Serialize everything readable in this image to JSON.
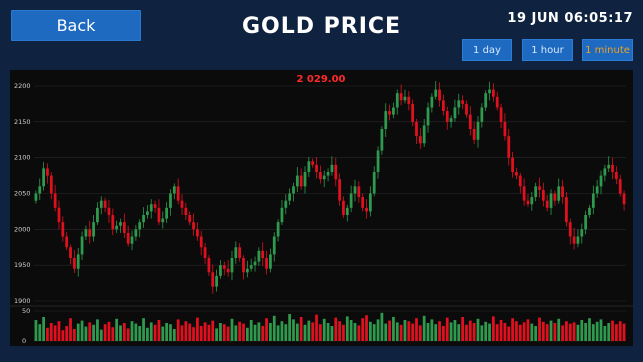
{
  "header": {
    "back_label": "Back",
    "title": "GOLD PRICE",
    "clock": "19 JUN 06:05:17"
  },
  "timeframes": [
    {
      "label": "1 day",
      "active": false
    },
    {
      "label": "1 hour",
      "active": false
    },
    {
      "label": "1 minute",
      "active": true
    }
  ],
  "colors": {
    "background": "#0f2340",
    "button": "#1d6ac0",
    "active_timeframe": "#f0a020",
    "up": "#2e9a4e",
    "down": "#e0101e",
    "doji": "#ffffff",
    "price_label": "#ff2a2a"
  },
  "chart_data": {
    "type": "candlestick",
    "current_price_label": "2 029.00",
    "price_axis": {
      "ticks": [
        1900,
        1950,
        2000,
        2050,
        2100,
        2150,
        2200
      ],
      "ylim": [
        1900,
        2200
      ]
    },
    "volume_axis": {
      "ticks": [
        0,
        50
      ],
      "ylim": [
        0,
        50
      ]
    },
    "close": [
      2050,
      2060,
      2085,
      2075,
      2050,
      2030,
      2010,
      1990,
      1975,
      1960,
      1945,
      1965,
      1990,
      2000,
      1990,
      2010,
      2030,
      2040,
      2030,
      2020,
      2000,
      2005,
      2010,
      1995,
      1980,
      1990,
      2000,
      2010,
      2020,
      2025,
      2035,
      2030,
      2010,
      2015,
      2030,
      2050,
      2060,
      2040,
      2030,
      2020,
      2010,
      2000,
      1990,
      1975,
      1960,
      1940,
      1920,
      1935,
      1950,
      1945,
      1940,
      1960,
      1975,
      1960,
      1940,
      1945,
      1950,
      1955,
      1970,
      1960,
      1945,
      1965,
      1990,
      2010,
      2030,
      2040,
      2050,
      2060,
      2075,
      2060,
      2080,
      2095,
      2090,
      2080,
      2070,
      2075,
      2080,
      2090,
      2070,
      2040,
      2020,
      2030,
      2050,
      2060,
      2045,
      2030,
      2025,
      2050,
      2080,
      2110,
      2140,
      2165,
      2160,
      2170,
      2190,
      2180,
      2185,
      2175,
      2150,
      2130,
      2120,
      2145,
      2170,
      2185,
      2195,
      2180,
      2165,
      2150,
      2155,
      2170,
      2180,
      2175,
      2160,
      2140,
      2125,
      2150,
      2170,
      2190,
      2195,
      2185,
      2170,
      2150,
      2130,
      2100,
      2080,
      2075,
      2060,
      2040,
      2035,
      2045,
      2060,
      2055,
      2040,
      2030,
      2050,
      2040,
      2060,
      2045,
      2010,
      1990,
      1980,
      1990,
      2000,
      2020,
      2030,
      2050,
      2060,
      2075,
      2085,
      2090,
      2080,
      2070,
      2050,
      2035
    ],
    "volume": [
      35,
      28,
      40,
      22,
      30,
      26,
      33,
      18,
      25,
      38,
      20,
      29,
      34,
      24,
      31,
      27,
      36,
      19,
      28,
      32,
      23,
      37,
      26,
      30,
      21,
      33,
      29,
      25,
      38,
      22,
      31,
      27,
      35,
      24,
      30,
      28,
      20,
      36,
      26,
      33,
      29,
      23,
      39,
      25,
      31,
      27,
      34,
      21,
      30,
      28,
      24,
      37,
      26,
      32,
      29,
      22,
      35,
      27,
      31,
      25,
      38,
      30,
      42,
      26,
      33,
      28,
      45,
      36,
      29,
      40,
      27,
      34,
      31,
      44,
      28,
      37,
      30,
      25,
      39,
      33,
      27,
      41,
      35,
      30,
      26,
      38,
      43,
      32,
      28,
      36,
      47,
      29,
      34,
      40,
      31,
      27,
      35,
      33,
      29,
      38,
      26,
      42,
      30,
      36,
      28,
      33,
      25,
      39,
      31,
      35,
      28,
      40,
      27,
      34,
      30,
      37,
      26,
      32,
      29,
      41,
      28,
      35,
      30,
      24,
      38,
      33,
      27,
      31,
      36,
      29,
      25,
      39,
      32,
      28,
      34,
      30,
      37,
      26,
      33,
      29,
      31,
      27,
      35,
      30,
      38,
      28,
      32,
      36,
      25,
      30,
      34,
      28,
      33,
      29
    ]
  }
}
